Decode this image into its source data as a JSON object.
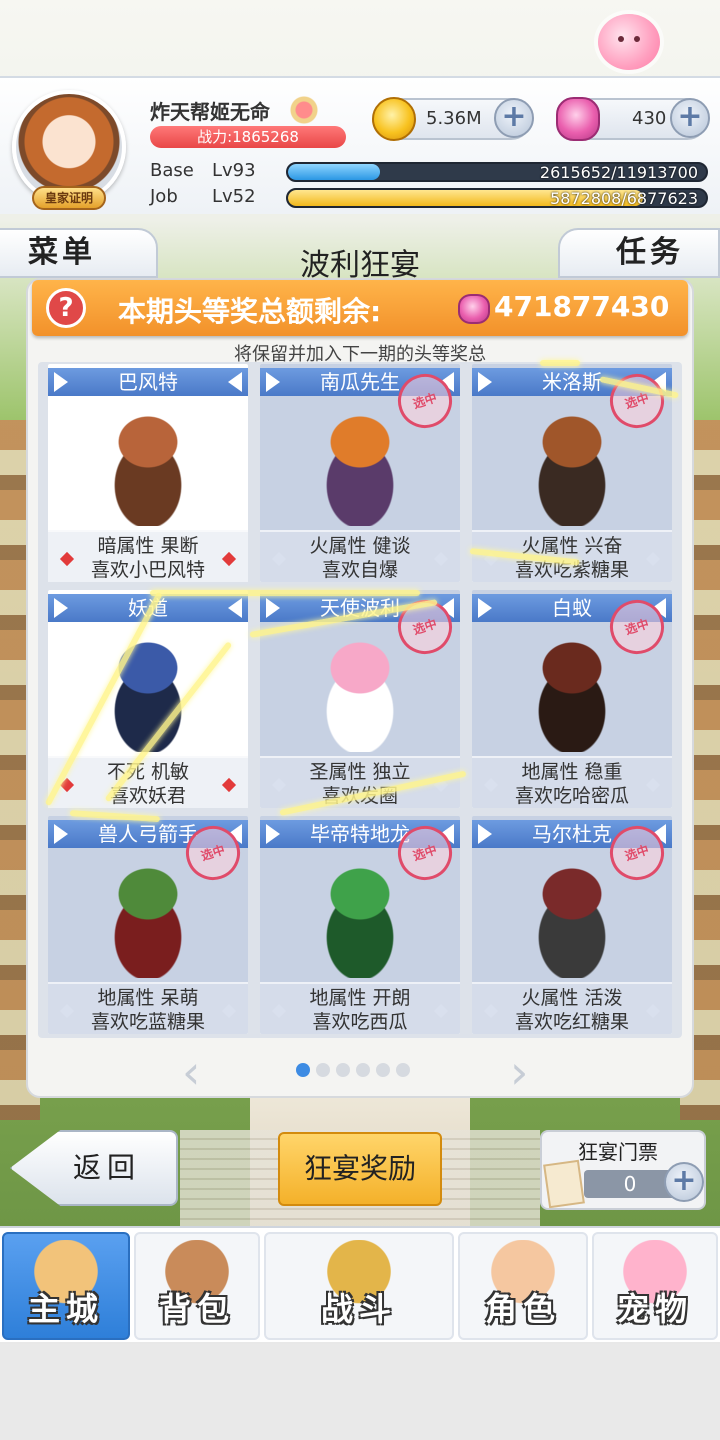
{
  "player": {
    "name": "炸天帮姬无命",
    "badge": "皇家证明",
    "power": "战力:1865268",
    "gold": "5.36M",
    "gems": "430",
    "base_label": "Base",
    "base_level": "Lv93",
    "base_exp": "2615652/11913700",
    "base_progress": 0.22,
    "job_label": "Job",
    "job_level": "Lv52",
    "job_exp": "5872808/6877623",
    "job_progress": 0.85
  },
  "tabs": {
    "menu": "菜单",
    "title": "波利狂宴",
    "quest": "任务"
  },
  "banner": {
    "label": "本期头等奖总额剩余:",
    "value": "471877430",
    "note": "将保留并加入下一期的头等奖总"
  },
  "cards": [
    {
      "name": "巴风特",
      "line1": "暗属性 果断",
      "line2": "喜欢小巴风特",
      "selected": true,
      "stamp": ""
    },
    {
      "name": "南瓜先生",
      "line1": "火属性 健谈",
      "line2": "喜欢自爆",
      "selected": false,
      "stamp": "选中"
    },
    {
      "name": "米洛斯",
      "line1": "火属性 兴奋",
      "line2": "喜欢吃紫糖果",
      "selected": false,
      "stamp": "选中"
    },
    {
      "name": "妖道",
      "line1": "不死 机敏",
      "line2": "喜欢妖君",
      "selected": true,
      "stamp": ""
    },
    {
      "name": "天使波利",
      "line1": "圣属性 独立",
      "line2": "喜欢发圈",
      "selected": false,
      "stamp": "选中"
    },
    {
      "name": "白蚁",
      "line1": "地属性 稳重",
      "line2": "喜欢吃哈密瓜",
      "selected": false,
      "stamp": "选中"
    },
    {
      "name": "兽人弓箭手",
      "line1": "地属性 呆萌",
      "line2": "喜欢吃蓝糖果",
      "selected": false,
      "stamp": "选中"
    },
    {
      "name": "毕帝特地龙",
      "line1": "地属性 开朗",
      "line2": "喜欢吃西瓜",
      "selected": false,
      "stamp": "选中"
    },
    {
      "name": "马尔杜克",
      "line1": "火属性 活泼",
      "line2": "喜欢吃红糖果",
      "selected": false,
      "stamp": "选中"
    }
  ],
  "pagination": {
    "pages": 6,
    "current": 1
  },
  "buttons": {
    "back": "返回",
    "feast_reward": "狂宴奖励",
    "ticket_title": "狂宴门票",
    "ticket_count": "0"
  },
  "nav": [
    {
      "label": "主城",
      "active": true
    },
    {
      "label": "背包",
      "active": false
    },
    {
      "label": "战斗",
      "active": false
    },
    {
      "label": "角色",
      "active": false
    },
    {
      "label": "宠物",
      "active": false
    }
  ],
  "colors": {
    "accent_blue": "#4a79c8",
    "banner_orange": "#f2912a",
    "power_red": "#e94747",
    "stamp_pink": "#e04b6a"
  }
}
